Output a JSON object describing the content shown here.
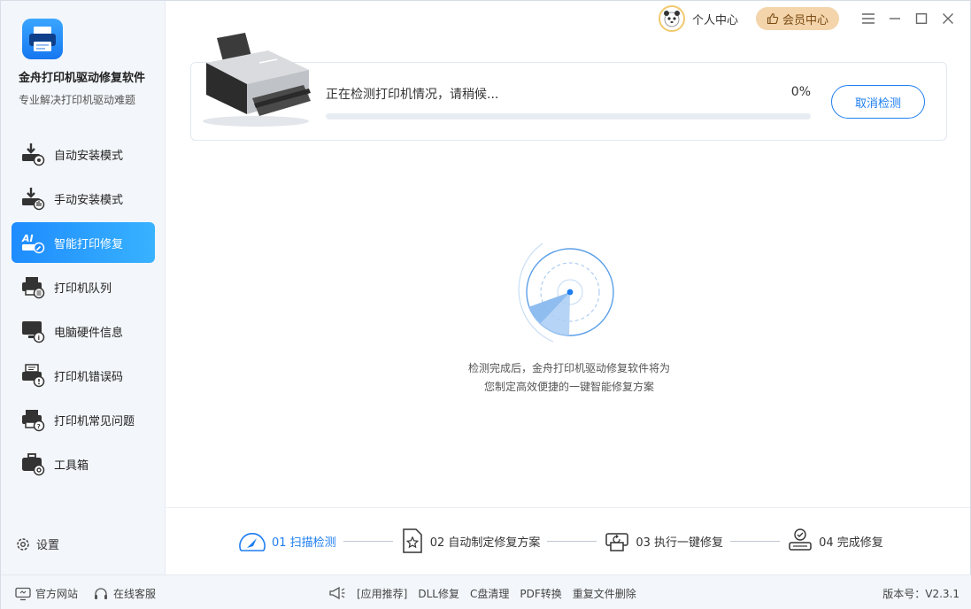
{
  "app": {
    "name": "金舟打印机驱动修复软件",
    "subtitle": "专业解决打印机驱动难题"
  },
  "sidebar": {
    "items": [
      {
        "label": "自动安装模式",
        "icon": "download-printer-icon"
      },
      {
        "label": "手动安装模式",
        "icon": "download-hand-icon"
      },
      {
        "label": "智能打印修复",
        "icon": "ai-repair-icon",
        "active": true
      },
      {
        "label": "打印机队列",
        "icon": "printer-queue-icon"
      },
      {
        "label": "电脑硬件信息",
        "icon": "monitor-info-icon"
      },
      {
        "label": "打印机错误码",
        "icon": "printer-error-icon"
      },
      {
        "label": "打印机常见问题",
        "icon": "printer-question-icon"
      },
      {
        "label": "工具箱",
        "icon": "toolbox-icon"
      }
    ],
    "settings_label": "设置"
  },
  "topbar": {
    "personal_label": "个人中心",
    "vip_label": "会员中心"
  },
  "scan": {
    "status_text": "正在检测打印机情况，请稍候...",
    "percent_text": "0%",
    "progress": 0,
    "cancel_label": "取消检测",
    "hint_line1": "检测完成后，金舟打印机驱动修复软件将为",
    "hint_line2": "您制定高效便捷的一键智能修复方案"
  },
  "steps": [
    {
      "label": "01 扫描检测",
      "active": true
    },
    {
      "label": "02 自动制定修复方案",
      "active": false
    },
    {
      "label": "03 执行一键修复",
      "active": false
    },
    {
      "label": "04 完成修复",
      "active": false
    }
  ],
  "footer": {
    "website_label": "官方网站",
    "service_label": "在线客服",
    "tools": [
      "[应用推荐]",
      "DLL修复",
      "C盘清理",
      "PDF转换",
      "重复文件删除"
    ],
    "version": "版本号：V2.3.1"
  },
  "colors": {
    "accent": "#1e8cff",
    "vip_bg": "#f3d4ab",
    "sidebar_bg": "#f3f6fa"
  }
}
